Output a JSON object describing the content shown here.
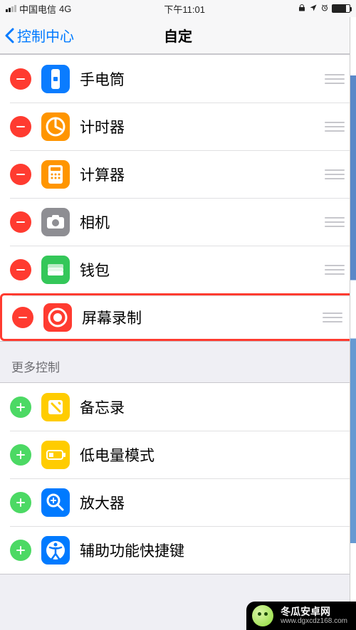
{
  "status_bar": {
    "carrier": "中国电信",
    "network": "4G",
    "time": "下午11:01"
  },
  "nav": {
    "back_label": "控制中心",
    "title": "自定"
  },
  "included": [
    {
      "key": "flashlight",
      "label": "手电筒",
      "icon": "flashlight-icon",
      "highlighted": false
    },
    {
      "key": "timer",
      "label": "计时器",
      "icon": "timer-icon",
      "highlighted": false
    },
    {
      "key": "calculator",
      "label": "计算器",
      "icon": "calculator-icon",
      "highlighted": false
    },
    {
      "key": "camera",
      "label": "相机",
      "icon": "camera-icon",
      "highlighted": false
    },
    {
      "key": "wallet",
      "label": "钱包",
      "icon": "wallet-icon",
      "highlighted": false
    },
    {
      "key": "screen_recording",
      "label": "屏幕录制",
      "icon": "screen-recording-icon",
      "highlighted": true
    }
  ],
  "more_section_header": "更多控制",
  "more": [
    {
      "key": "notes",
      "label": "备忘录",
      "icon": "notes-icon"
    },
    {
      "key": "low_power",
      "label": "低电量模式",
      "icon": "low-power-icon"
    },
    {
      "key": "magnifier",
      "label": "放大器",
      "icon": "magnifier-icon"
    },
    {
      "key": "accessibility_shortcut",
      "label": "辅助功能快捷键",
      "icon": "accessibility-icon"
    }
  ],
  "watermark": {
    "name": "冬瓜安卓网",
    "url": "www.dgxcdz168.com"
  },
  "colors": {
    "remove": "#ff3b30",
    "add": "#4cd964",
    "accent": "#007aff"
  }
}
